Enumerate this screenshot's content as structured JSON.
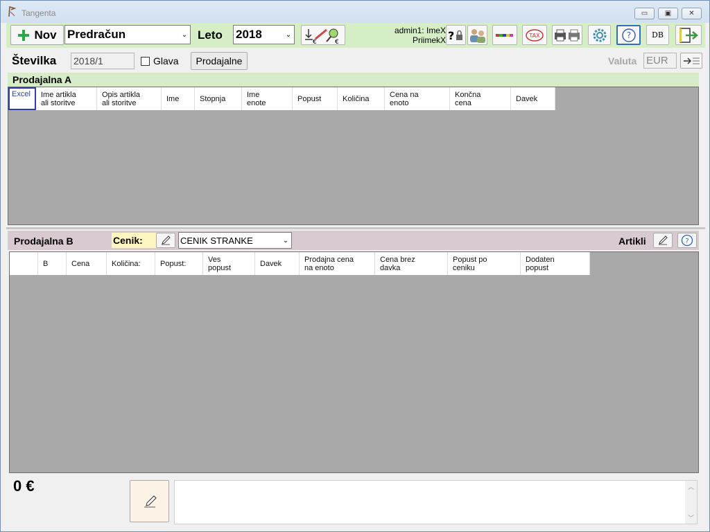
{
  "window": {
    "title": "Tangenta",
    "controls": {
      "minimize": "▭",
      "restore": "▣",
      "close": "✕"
    }
  },
  "toolbar": {
    "new_label": "Nov",
    "doc_type": "Predračun",
    "year_label": "Leto",
    "year_value": "2018",
    "user_line1": "admin1: ImeX",
    "user_line2": "PriimekX",
    "db_label": "DB",
    "tax_label": "TAX"
  },
  "invoice": {
    "number_label": "Številka",
    "number_value": "2018/1",
    "head_label": "Glava",
    "shops_button": "Prodajalne",
    "currency_label": "Valuta",
    "currency_value": "EUR"
  },
  "panel_a": {
    "title": "Prodajalna A",
    "excel_label": "Excel",
    "columns": [
      "Ime artikla\nali storitve",
      "Opis artikla\nali storitve",
      "Ime",
      "Stopnja",
      "Ime\nenote",
      "Popust",
      "Količina",
      "Cena na\nenoto",
      "Končna\ncena",
      "Davek"
    ]
  },
  "panel_b": {
    "title": "Prodajalna B",
    "pricelist_label": "Cenik:",
    "pricelist_value": "CENIK STRANKE",
    "articles_label": "Artikli",
    "columns": [
      "",
      "B",
      "Cena",
      "Količina:",
      "Popust:",
      "Ves\npopust",
      "Davek",
      "Prodajna cena\nna enoto",
      "Cena brez\ndavka",
      "Popust po\nceniku",
      "Dodaten\npopust"
    ]
  },
  "footer": {
    "total": "0 €",
    "note": ""
  },
  "colors": {
    "toolbar_bg": "#d5eec5",
    "panel_a_bg": "#d6ecc9",
    "panel_b_bg": "#d9c9d0",
    "grid_bg": "#a9a9a9",
    "cenik_bg": "#fdf6c0"
  }
}
